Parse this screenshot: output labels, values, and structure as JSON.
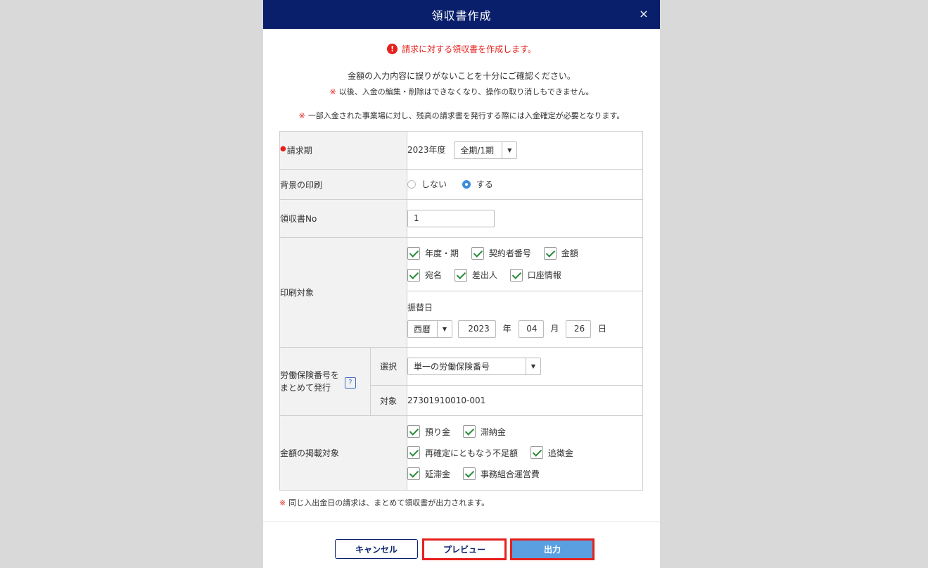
{
  "modal": {
    "title": "領収書作成",
    "close": "×",
    "error_notice": "請求に対する領収書を作成します。",
    "msg1": "金額の入力内容に誤りがないことを十分にご確認ください。",
    "msg2": "以後、入金の編集・削除はできなくなり、操作の取り消しもできません。",
    "msg3": "一部入金された事業場に対し、残高の請求書を発行する際には入金確定が必要となります。",
    "kome": "※",
    "footer_note": "同じ入出金日の請求は、まとめて領収書が出力されます。"
  },
  "form": {
    "period": {
      "label": "請求期",
      "year_text": "2023年度",
      "select_value": "全期/1期"
    },
    "background": {
      "label": "背景の印刷",
      "options": [
        "しない",
        "する"
      ],
      "selected": "する"
    },
    "receipt_no": {
      "label": "領収書No",
      "value": "1"
    },
    "print_target": {
      "label": "印刷対象",
      "checks_row1": [
        "年度・期",
        "契約者番号",
        "金額"
      ],
      "checks_row2": [
        "宛名",
        "差出人",
        "口座情報"
      ],
      "transfer_label": "振替日",
      "era": "西暦",
      "year": "2023",
      "year_unit": "年",
      "month": "04",
      "month_unit": "月",
      "day": "26",
      "day_unit": "日"
    },
    "labor_insurance": {
      "label_line1": "労働保険番号を",
      "label_line2": "まとめて発行",
      "help": "?",
      "select_label": "選択",
      "select_value": "単一の労働保険番号",
      "target_label": "対象",
      "target_value": "27301910010-001"
    },
    "amount_targets": {
      "label": "金額の掲載対象",
      "row1": [
        "預り金",
        "滞納金"
      ],
      "row2": [
        "再確定にともなう不足額",
        "追徴金"
      ],
      "row3": [
        "延滞金",
        "事務組合運営費"
      ]
    }
  },
  "buttons": {
    "cancel": "キャンセル",
    "preview": "プレビュー",
    "output": "出力"
  }
}
